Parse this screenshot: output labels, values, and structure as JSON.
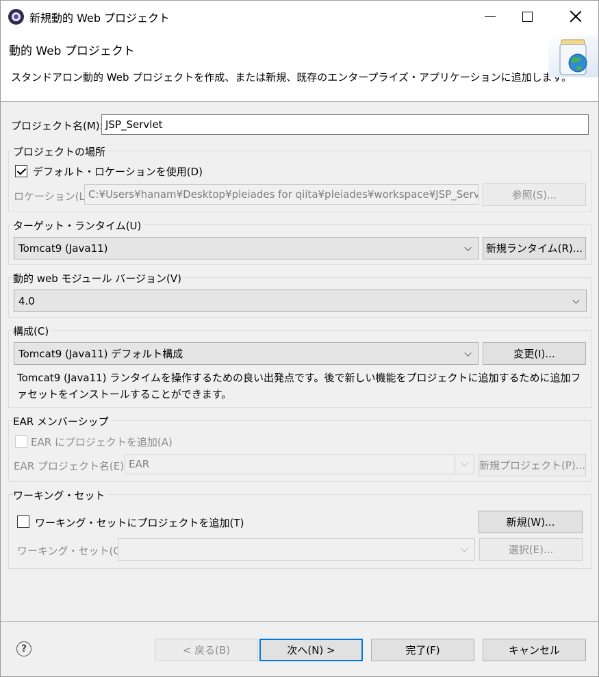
{
  "window": {
    "title": "新規動的 Web プロジェクト",
    "icon": "eclipse-icon"
  },
  "banner": {
    "title": "動的 Web プロジェクト",
    "description": "スタンドアロン動的 Web プロジェクトを作成、または新規、既存のエンタープライズ・アプリケーションに追加します。",
    "icon": "web-project-wizard-icon"
  },
  "project": {
    "name_label": "プロジェクト名(M):",
    "name_value": "JSP_Servlet"
  },
  "location": {
    "group_title": "プロジェクトの場所",
    "default_checkbox_label": "デフォルト・ロケーションを使用(D)",
    "default_checked": true,
    "location_label": "ロケーション(L):",
    "location_value": "C:¥Users¥hanam¥Desktop¥pleiades for qiita¥pleiades¥workspace¥JSP_Servlet",
    "browse_button": "参照(S)..."
  },
  "target_runtime": {
    "group_title": "ターゲット・ランタイム(U)",
    "selected": "Tomcat9 (Java11)",
    "new_runtime_button": "新規ランタイム(R)..."
  },
  "module_version": {
    "group_title": "動的 web モジュール バージョン(V)",
    "selected": "4.0"
  },
  "configuration": {
    "group_title": "構成(C)",
    "selected": "Tomcat9 (Java11) デフォルト構成",
    "modify_button": "変更(I)...",
    "description": "Tomcat9 (Java11) ランタイムを操作するための良い出発点です。後で新しい機能をプロジェクトに追加するために追加ファセットをインストールすることができます。"
  },
  "ear": {
    "group_title": "EAR メンバーシップ",
    "add_checkbox_label": "EAR にプロジェクトを追加(A)",
    "add_checked": false,
    "project_name_label": "EAR プロジェクト名(E):",
    "project_name_value": "EAR",
    "new_project_button": "新規プロジェクト(P)..."
  },
  "working_set": {
    "group_title": "ワーキング・セット",
    "add_checkbox_label": "ワーキング・セットにプロジェクトを追加(T)",
    "add_checked": false,
    "new_button": "新規(W)...",
    "sets_label": "ワーキング・セット(O):",
    "sets_value": "",
    "select_button": "選択(E)..."
  },
  "footer": {
    "help": "?",
    "back_button": "< 戻る(B)",
    "next_button": "次へ(N) >",
    "finish_button": "完了(F)",
    "cancel_button": "キャンセル"
  },
  "colors": {
    "default_button_border": "#0078d7",
    "dialog_background": "#f0f0f0"
  }
}
